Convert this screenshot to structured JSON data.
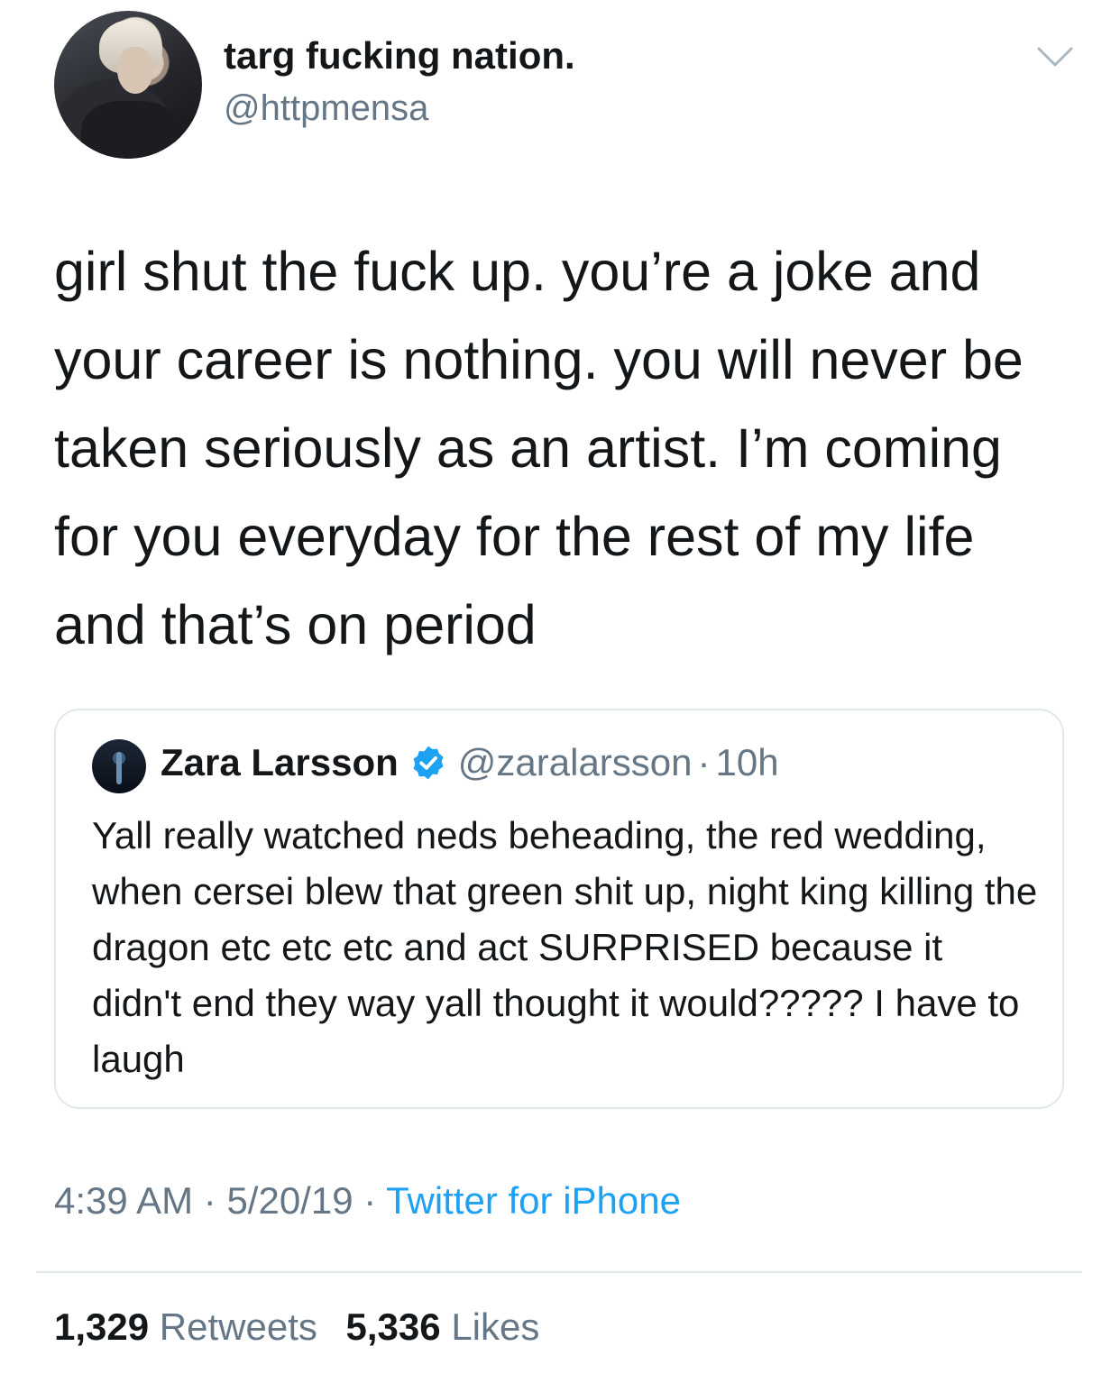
{
  "tweet": {
    "author": {
      "display_name": "targ fucking nation.",
      "handle": "@httpmensa"
    },
    "text": "girl shut the fuck up. you’re a joke and your career is nothing. you will never be taken seriously as an artist. I’m coming for you everyday for the rest of my life and that’s on period",
    "icons": {
      "menu": "chevron-down-icon",
      "verified": "verified-badge-icon"
    }
  },
  "quoted_tweet": {
    "display_name": "Zara Larsson",
    "handle": "@zaralarsson",
    "separator": "·",
    "age": "10h",
    "text": "Yall really watched neds beheading, the red wedding, when cersei blew that green shit up, night king killing the dragon etc etc etc and act SURPRISED because it didn't end they way yall thought it would????? I have to laugh"
  },
  "meta": {
    "time": "4:39 AM",
    "sep1": " · ",
    "date": "5/20/19",
    "sep2": " · ",
    "source": "Twitter for iPhone"
  },
  "stats": {
    "retweets_count": "1,329",
    "retweets_label": "Retweets",
    "likes_count": "5,336",
    "likes_label": "Likes"
  },
  "colors": {
    "text": "#14171a",
    "secondary": "#657786",
    "link": "#1da1f2",
    "border": "#e1e8ed",
    "verified": "#1da1f2"
  }
}
